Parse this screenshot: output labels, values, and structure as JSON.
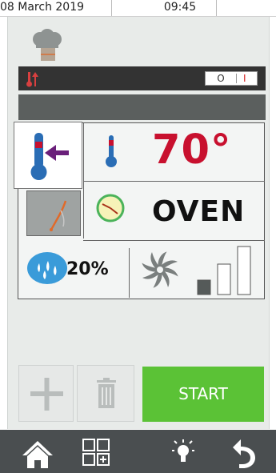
{
  "status": {
    "date": "08 March 2019",
    "time": "09:45"
  },
  "header": {
    "toggle_off": "O",
    "toggle_on": "I"
  },
  "program": {
    "temperature": "70°",
    "mode": "OVEN",
    "humidity": "20%",
    "fan_level": 1,
    "fan_levels_total": 3
  },
  "actions": {
    "start_label": "START"
  },
  "colors": {
    "temp_red": "#c8102e",
    "start_green": "#5bc236",
    "nav_bg": "#4a4e50",
    "thermo_blue": "#2a6db5",
    "arrow_purple": "#6a1f7a"
  },
  "icons": {
    "chef": "chef-hat-icon",
    "preheat": "thermometer-arrow-icon",
    "core_probe": "core-probe-icon",
    "clock": "clock-icon",
    "humidity": "humidity-drops-icon",
    "fan": "fan-icon",
    "add": "plus-icon",
    "delete": "trash-icon",
    "home": "home-icon",
    "menu": "grid-add-icon",
    "light": "lightbulb-icon",
    "back": "back-arrow-icon"
  }
}
